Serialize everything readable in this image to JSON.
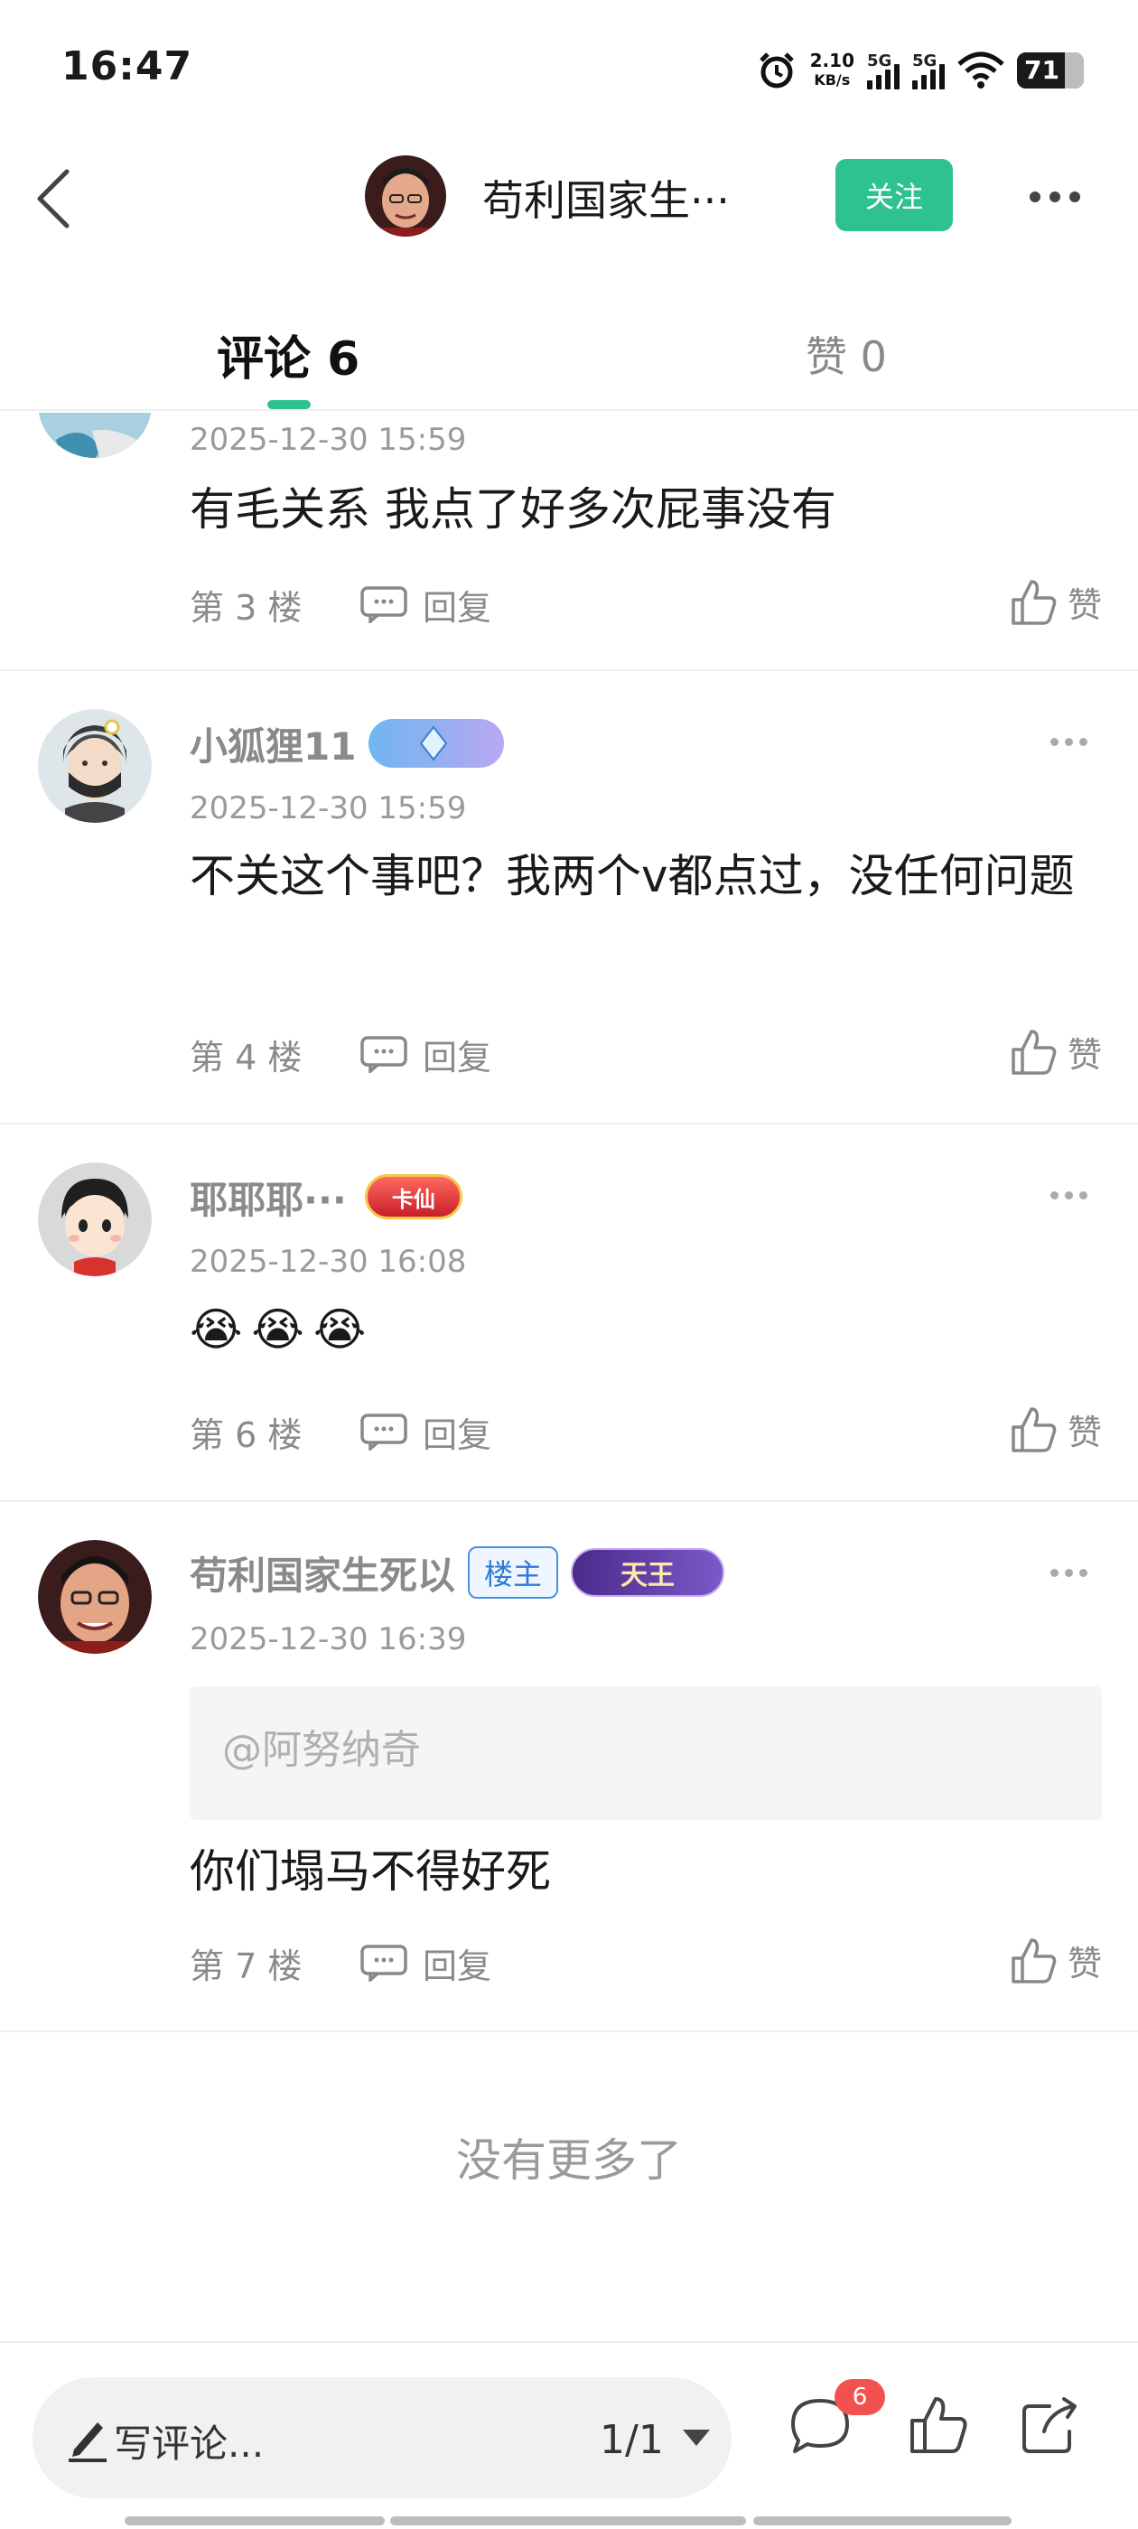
{
  "status_bar": {
    "time": "16:47",
    "net_speed_value": "2.10",
    "net_speed_unit": "KB/s",
    "signal1": "5G",
    "signal2": "5G",
    "battery": "71",
    "battery_level": 0.71,
    "icons": [
      "alarm-icon",
      "signal-icon",
      "signal-icon",
      "wifi-icon",
      "battery-icon"
    ]
  },
  "header": {
    "title": "苟利国家生···",
    "follow_label": "关注"
  },
  "tabs": {
    "comments_label": "评论 6",
    "likes_label": "赞 0"
  },
  "comments": [
    {
      "name": "",
      "time": "2025-12-30 15:59",
      "text": "有毛关系 我点了好多次屁事没有",
      "floor": "第 3 楼",
      "reply": "回复",
      "like": "赞"
    },
    {
      "name": "小狐狸11",
      "badge": "",
      "time": "2025-12-30 15:59",
      "text": "不关这个事吧？我两个v都点过，没任何问题",
      "floor": "第 4 楼",
      "reply": "回复",
      "like": "赞"
    },
    {
      "name": "耶耶耶···",
      "badge": "卡仙",
      "time": "2025-12-30 16:08",
      "text": "😭😭😭",
      "floor": "第 6 楼",
      "reply": "回复",
      "like": "赞"
    },
    {
      "name": "苟利国家生死以",
      "owner_tag": "楼主",
      "badge": "天王",
      "time": "2025-12-30 16:39",
      "quote": "@阿努纳奇",
      "text": "你们塌马不得好死",
      "floor": "第 7 楼",
      "reply": "回复",
      "like": "赞"
    }
  ],
  "footer_note": "没有更多了",
  "bottom_bar": {
    "write_placeholder": "写评论...",
    "pager": "1/1",
    "comment_count": "6"
  },
  "colors": {
    "accent": "#2ec28f",
    "badge_red": "#f2524f",
    "owner_blue": "#2d7ad6"
  }
}
